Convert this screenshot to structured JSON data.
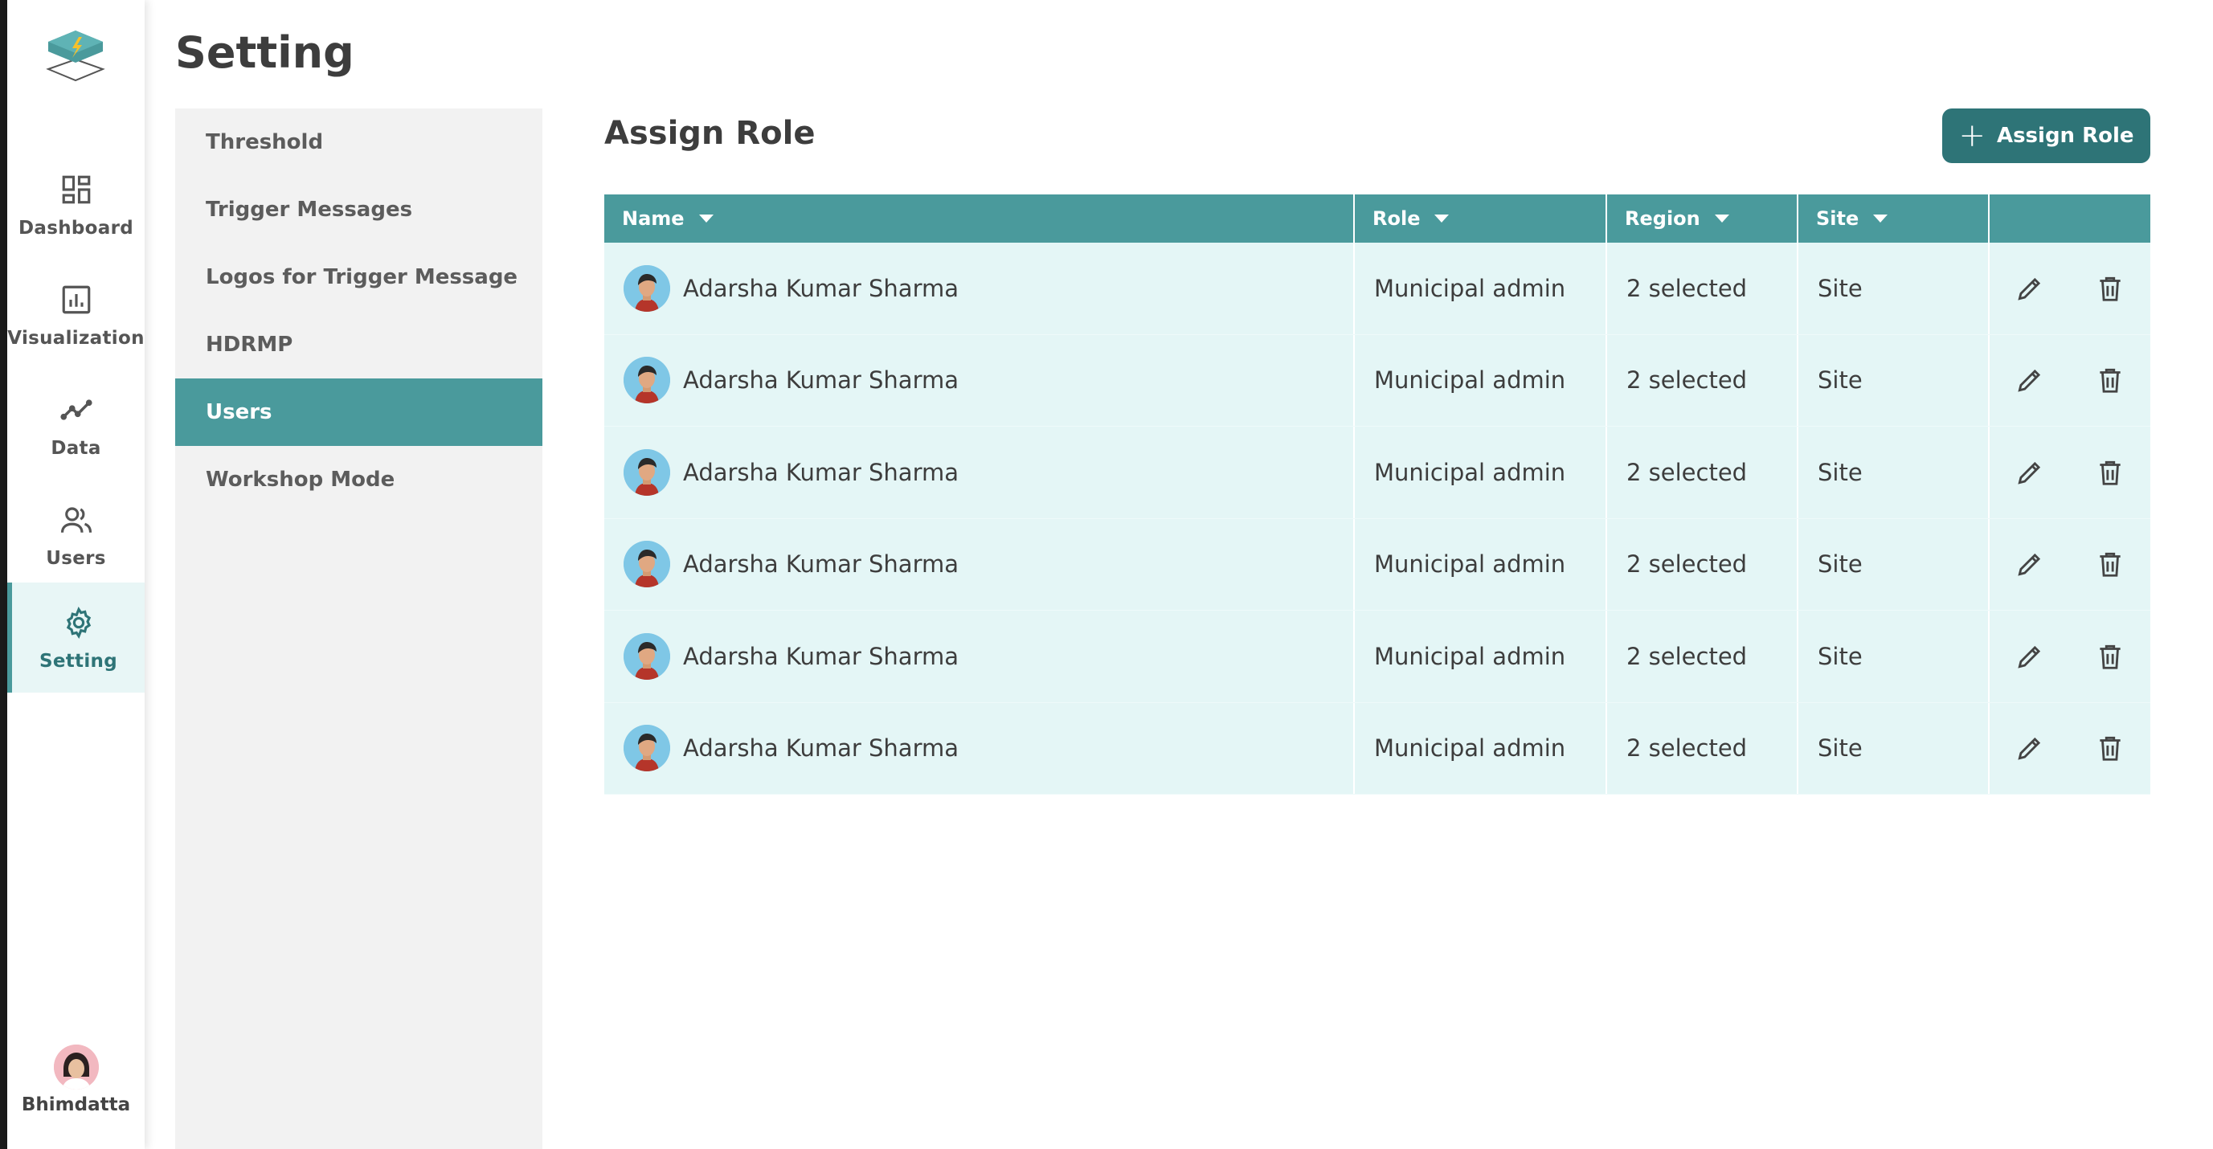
{
  "app": {
    "page_title": "Setting",
    "brand_colors": {
      "primary": "#4a9a9c",
      "primary_dark": "#2e7477",
      "row_bg": "#e4f6f6"
    }
  },
  "sidebar": {
    "items": [
      {
        "label": "Dashboard",
        "icon": "dashboard-icon"
      },
      {
        "label": "Visualization",
        "icon": "chart-icon"
      },
      {
        "label": "Data",
        "icon": "trend-line-icon"
      },
      {
        "label": "Users",
        "icon": "users-icon"
      },
      {
        "label": "Setting",
        "icon": "gear-icon",
        "active": true
      }
    ],
    "profile": {
      "name": "Bhimdatta"
    }
  },
  "submenu": {
    "items": [
      {
        "label": "Threshold"
      },
      {
        "label": "Trigger Messages"
      },
      {
        "label": "Logos for Trigger Message"
      },
      {
        "label": "HDRMP"
      },
      {
        "label": "Users",
        "active": true
      },
      {
        "label": "Workshop Mode"
      }
    ]
  },
  "content": {
    "title": "Assign Role",
    "assign_button_label": "Assign Role"
  },
  "table": {
    "columns": [
      "Name",
      "Role",
      "Region",
      "Site"
    ],
    "rows": [
      {
        "name": "Adarsha Kumar Sharma",
        "role": "Municipal admin",
        "region": "2 selected",
        "site": "Site"
      },
      {
        "name": "Adarsha Kumar Sharma",
        "role": "Municipal admin",
        "region": "2 selected",
        "site": "Site"
      },
      {
        "name": "Adarsha Kumar Sharma",
        "role": "Municipal admin",
        "region": "2 selected",
        "site": "Site"
      },
      {
        "name": "Adarsha Kumar Sharma",
        "role": "Municipal admin",
        "region": "2 selected",
        "site": "Site"
      },
      {
        "name": "Adarsha Kumar Sharma",
        "role": "Municipal admin",
        "region": "2 selected",
        "site": "Site"
      },
      {
        "name": "Adarsha Kumar Sharma",
        "role": "Municipal admin",
        "region": "2 selected",
        "site": "Site"
      }
    ]
  }
}
